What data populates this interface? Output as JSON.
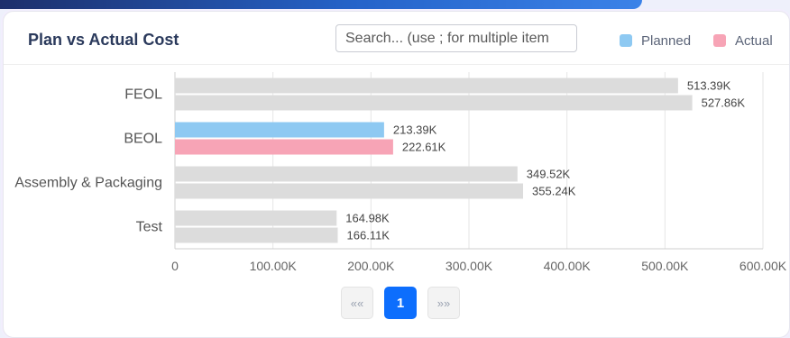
{
  "card": {
    "title": "Plan vs Actual Cost",
    "search_placeholder": "Search... (use ; for multiple item"
  },
  "legend": [
    {
      "label": "Planned",
      "color": "#8ec9f2"
    },
    {
      "label": "Actual",
      "color": "#f7a4b6"
    }
  ],
  "pagination": {
    "first_label": "««",
    "current_page": "1",
    "last_label": "»»"
  },
  "chart_data": {
    "type": "bar",
    "orientation": "horizontal",
    "title": "Plan vs Actual Cost",
    "categories": [
      "FEOL",
      "BEOL",
      "Assembly & Packaging",
      "Test"
    ],
    "series": [
      {
        "name": "Planned",
        "color": "#8ec9f2",
        "values": [
          513390,
          213390,
          349520,
          164980
        ],
        "labels": [
          "513.39K",
          "213.39K",
          "349.52K",
          "164.98K"
        ]
      },
      {
        "name": "Actual",
        "color": "#f7a4b6",
        "values": [
          527860,
          222610,
          355240,
          166110
        ],
        "labels": [
          "527.86K",
          "222.61K",
          "355.24K",
          "166.11K"
        ]
      }
    ],
    "highlighted_category": "BEOL",
    "inactive_bar_color": "#dcdcdc",
    "x_ticks": [
      0,
      100000,
      200000,
      300000,
      400000,
      500000,
      600000
    ],
    "x_tick_labels": [
      "0",
      "100.00K",
      "200.00K",
      "300.00K",
      "400.00K",
      "500.00K",
      "600.00K"
    ],
    "xlim": [
      0,
      600000
    ],
    "grid": true,
    "legend_position": "top-right"
  }
}
